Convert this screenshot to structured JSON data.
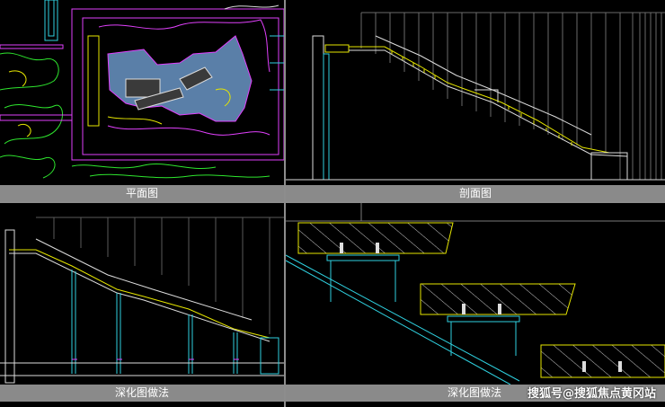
{
  "panels": [
    {
      "caption": "平面图"
    },
    {
      "caption": "剖面图"
    },
    {
      "caption": "深化图做法"
    },
    {
      "caption": "深化图做法"
    }
  ],
  "watermark": "搜狐号@搜狐焦点黄冈站",
  "colors": {
    "background": "#000000",
    "caption_bar": "#8a8a8a",
    "cad_magenta": "#e040fb",
    "cad_cyan": "#2fd1e0",
    "cad_yellow": "#e6e600",
    "cad_green": "#2ee62e",
    "cad_white": "#dcdcdc"
  }
}
